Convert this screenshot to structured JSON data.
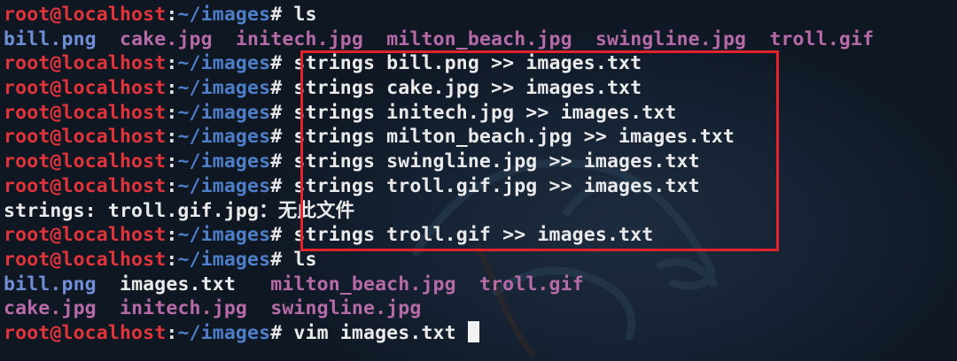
{
  "prompt": {
    "user_host": "root@localhost",
    "separator": ":",
    "path": "~/images",
    "symbol": "#"
  },
  "lines": [
    {
      "type": "prompt",
      "command": " ls"
    },
    {
      "type": "listing",
      "items": [
        {
          "text": "bill.png",
          "kind": "png",
          "gap": "  "
        },
        {
          "text": "cake.jpg",
          "kind": "img",
          "gap": "  "
        },
        {
          "text": "initech.jpg",
          "kind": "img",
          "gap": "  "
        },
        {
          "text": "milton_beach.jpg",
          "kind": "img",
          "gap": "  "
        },
        {
          "text": "swingline.jpg",
          "kind": "img",
          "gap": "  "
        },
        {
          "text": "troll.gif",
          "kind": "img",
          "gap": ""
        }
      ]
    },
    {
      "type": "prompt",
      "command": " strings bill.png >> images.txt"
    },
    {
      "type": "prompt",
      "command": " strings cake.jpg >> images.txt"
    },
    {
      "type": "prompt",
      "command": " strings initech.jpg >> images.txt"
    },
    {
      "type": "prompt",
      "command": " strings milton_beach.jpg >> images.txt"
    },
    {
      "type": "prompt",
      "command": " strings swingline.jpg >> images.txt"
    },
    {
      "type": "prompt",
      "command": " strings troll.gif.jpg >> images.txt"
    },
    {
      "type": "output",
      "text": "strings: troll.gif.jpg：无此文件"
    },
    {
      "type": "prompt",
      "command": " strings troll.gif >> images.txt"
    },
    {
      "type": "prompt",
      "command": " ls"
    },
    {
      "type": "listing",
      "items": [
        {
          "text": "bill.png",
          "kind": "png",
          "gap": "  "
        },
        {
          "text": "images.txt",
          "kind": "txt",
          "gap": "   "
        },
        {
          "text": "milton_beach.jpg",
          "kind": "img",
          "gap": "  "
        },
        {
          "text": "troll.gif",
          "kind": "img",
          "gap": ""
        }
      ]
    },
    {
      "type": "listing",
      "items": [
        {
          "text": "cake.jpg",
          "kind": "img",
          "gap": "  "
        },
        {
          "text": "initech.jpg",
          "kind": "img",
          "gap": "  "
        },
        {
          "text": "swingline.jpg",
          "kind": "img",
          "gap": ""
        }
      ]
    },
    {
      "type": "prompt",
      "command": " vim images.txt ",
      "cursor": true
    }
  ],
  "colors": {
    "background": "#0f1723",
    "user_host": "#e0343a",
    "path": "#4e7ec8",
    "png_file": "#6f8fd6",
    "image_file": "#b66aa8",
    "highlight_border": "#e3232b"
  },
  "icons": {
    "watermark": "kali-dragon-watermark",
    "cursor": "block-cursor"
  }
}
